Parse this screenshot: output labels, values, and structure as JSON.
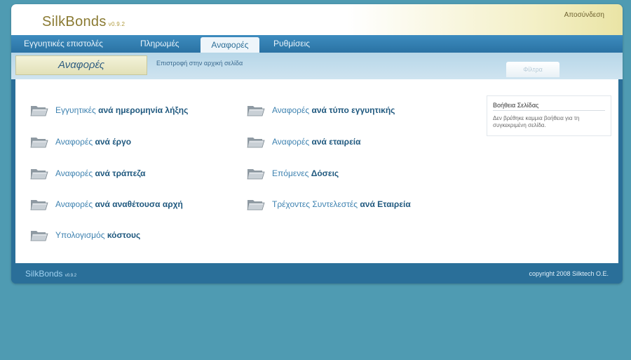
{
  "header": {
    "brand": "SilkBonds",
    "version": "v0.9.2",
    "logout": "Αποσύνδεση"
  },
  "tabs": [
    {
      "label": "Εγγυητικές επιστολές"
    },
    {
      "label": "Πληρωμές"
    },
    {
      "label": "Αναφορές",
      "active": true
    },
    {
      "label": "Ρυθμίσεις"
    }
  ],
  "subbar": {
    "section_title": "Αναφορές",
    "back_link": "Επιστροφή στην αρχική σελίδα",
    "filter_button": "Φίλτρα"
  },
  "reports": {
    "left": [
      {
        "prefix": "Εγγυητικές",
        "bold": "ανά ημερομηνία λήξης"
      },
      {
        "prefix": "Αναφορές",
        "bold": "ανά έργο"
      },
      {
        "prefix": "Αναφορές",
        "bold": "ανά τράπεζα"
      },
      {
        "prefix": "Αναφορές",
        "bold": "ανά αναθέτουσα αρχή"
      },
      {
        "prefix": "Υπολογισμός",
        "bold": "κόστους"
      }
    ],
    "right": [
      {
        "prefix": "Αναφορές",
        "bold": "ανά τύπο εγγυητικής"
      },
      {
        "prefix": "Αναφορές",
        "bold": "ανά εταιρεία"
      },
      {
        "prefix": "Επόμενες",
        "bold": "Δόσεις"
      },
      {
        "prefix": "Τρέχοντες Συντελεστές",
        "bold": "ανά Εταιρεία"
      }
    ]
  },
  "help": {
    "title": "Βοήθεια Σελίδας",
    "text": "Δεν βρέθηκε καμμια βοήθεια για τη συγκεκριμένη σελίδα."
  },
  "footer": {
    "brand": "SilkBonds",
    "version": "v0.9.2",
    "copyright": "copyright 2008 Silktech O.E."
  },
  "colors": {
    "background": "#4f9bb2",
    "nav": "#2a6f99",
    "link": "#3e82b0",
    "link_bold": "#20597f"
  }
}
